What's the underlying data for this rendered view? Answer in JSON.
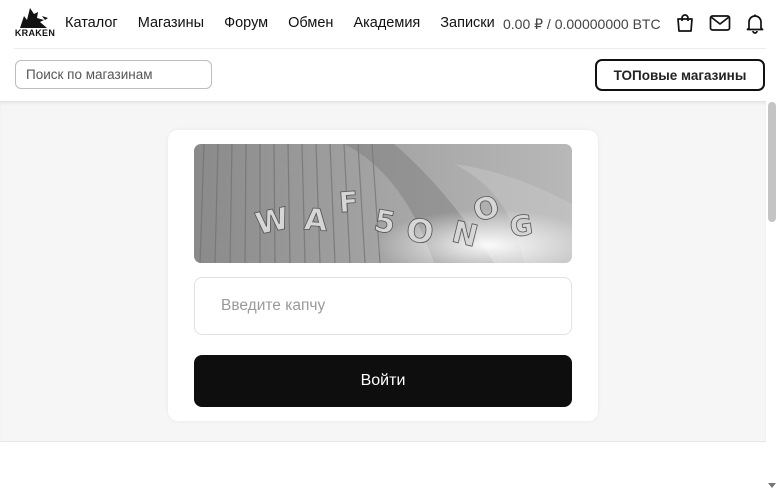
{
  "header": {
    "logo_text": "KRAKEN",
    "nav": [
      "Каталог",
      "Магазины",
      "Форум",
      "Обмен",
      "Академия",
      "Записки"
    ],
    "balance": "0.00 ₽ / 0.00000000 BTC",
    "icons": [
      "shopping-bag-icon",
      "mail-icon",
      "bell-icon"
    ]
  },
  "subbar": {
    "search_placeholder": "Поиск по магазинам",
    "top_button": "ТОПовые магазины"
  },
  "login": {
    "captcha_placeholder": "Введите капчу",
    "submit_label": "Войти"
  }
}
